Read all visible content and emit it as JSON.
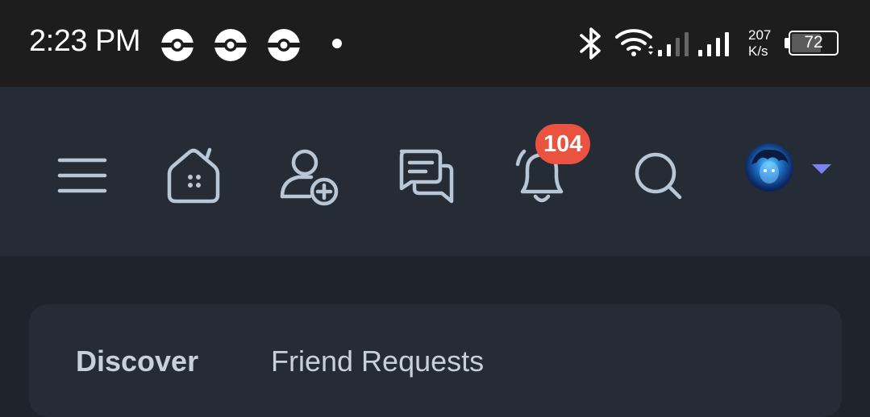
{
  "status_bar": {
    "time": "2:23 PM",
    "app_icons": [
      "pokeball-icon",
      "pokeball-icon",
      "pokeball-icon"
    ],
    "net_speed_value": "207",
    "net_speed_unit": "K/s",
    "battery_level": "72",
    "icons": [
      "bluetooth-icon",
      "wifi-icon",
      "signal-icon",
      "signal-icon"
    ]
  },
  "nav": {
    "items": [
      {
        "name": "menu-icon"
      },
      {
        "name": "home-icon"
      },
      {
        "name": "add-friend-icon"
      },
      {
        "name": "messages-icon"
      },
      {
        "name": "notifications-icon"
      },
      {
        "name": "search-icon"
      }
    ],
    "notification_count": "104"
  },
  "tabs": [
    {
      "label": "Discover",
      "active": true
    },
    {
      "label": "Friend Requests",
      "active": false
    }
  ],
  "colors": {
    "status_bg": "#1d1d1d",
    "nav_bg": "#252c36",
    "page_bg": "#1e242c",
    "icon": "#b9c6d6",
    "badge": "#e9533f",
    "caret": "#7b83f0"
  }
}
